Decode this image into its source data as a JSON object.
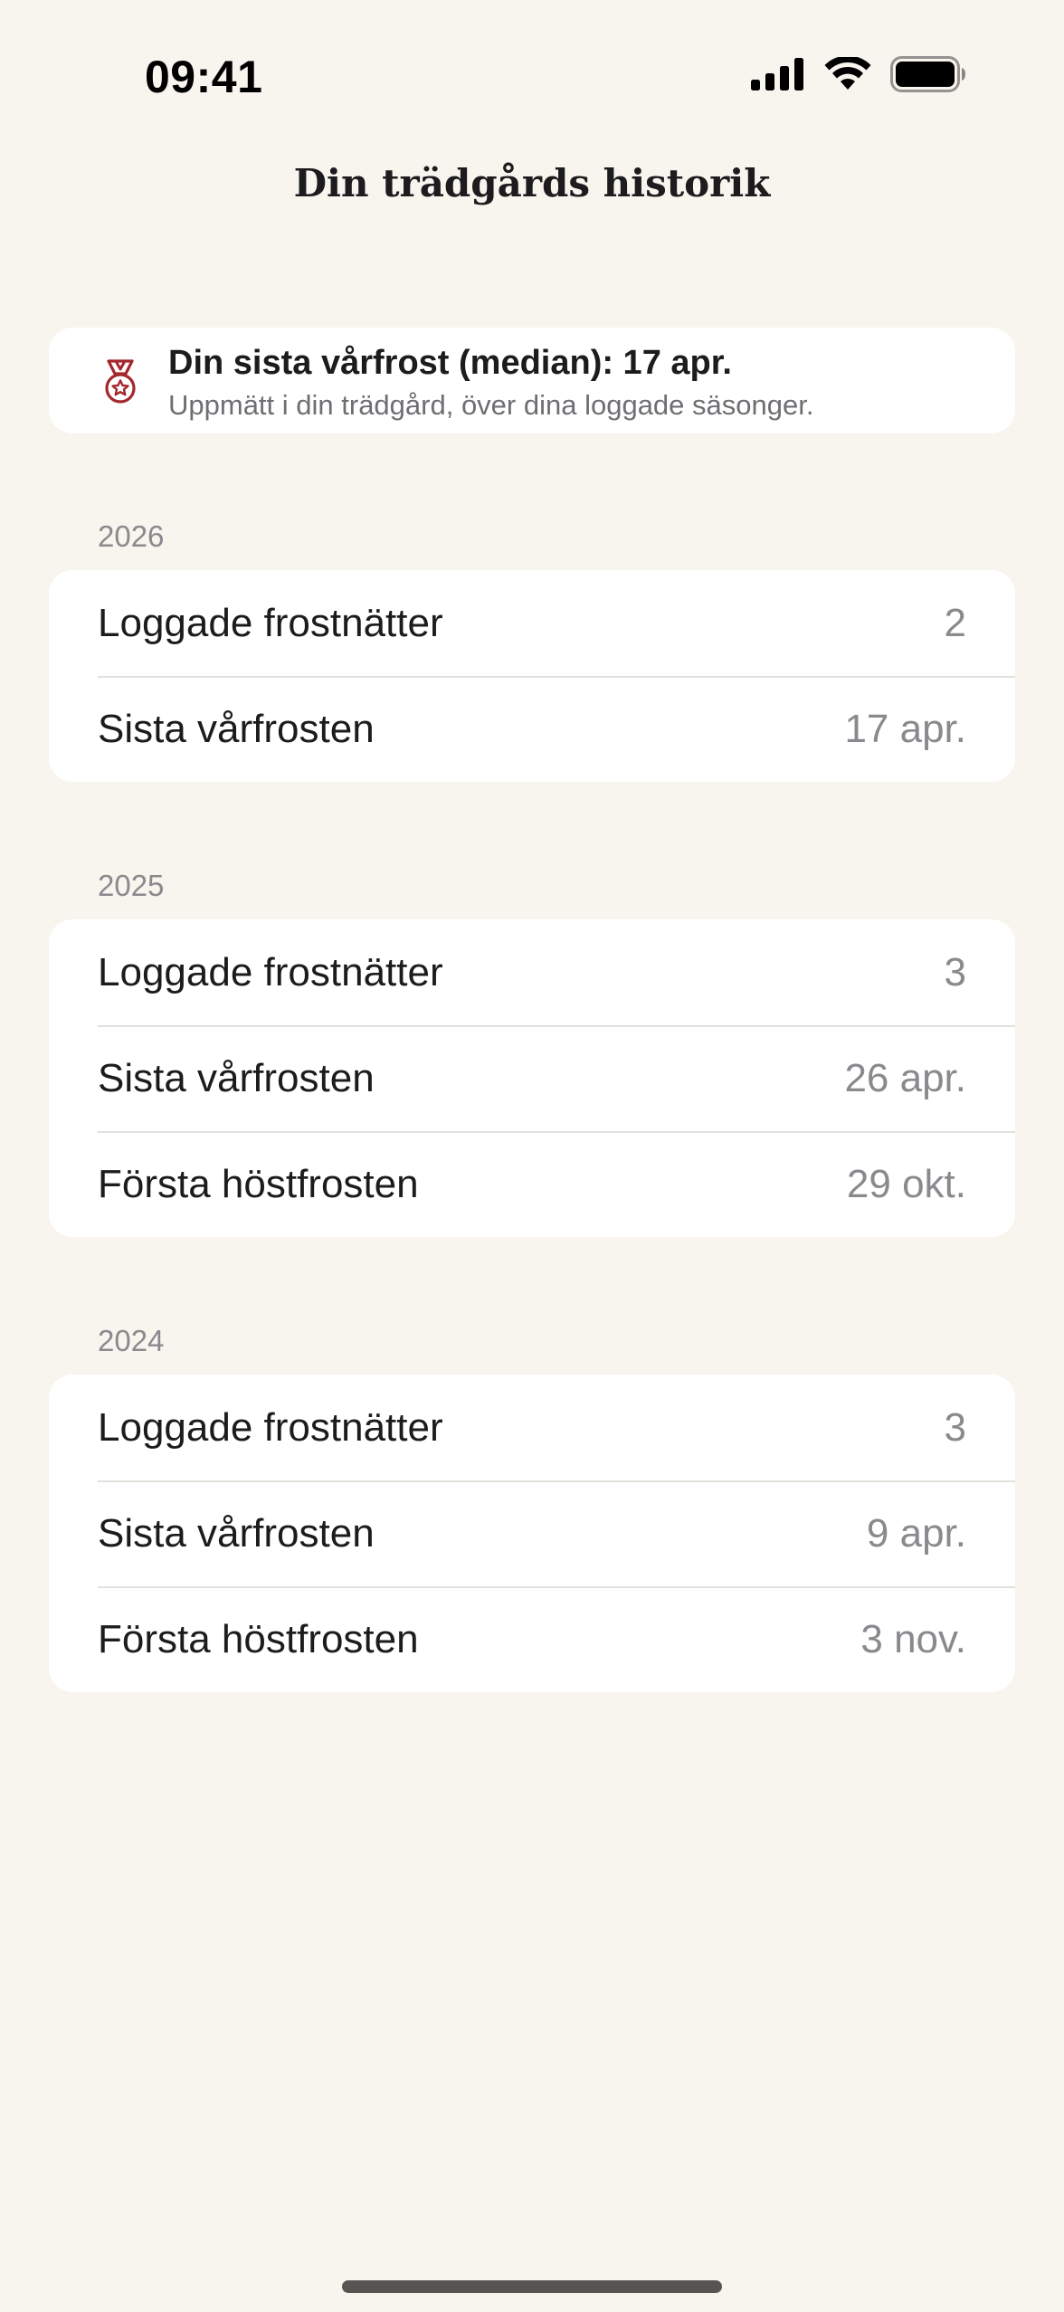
{
  "status_bar": {
    "time": "09:41",
    "signal_icon": "cellular-signal-icon",
    "wifi_icon": "wifi-icon",
    "battery_icon": "battery-icon"
  },
  "nav": {
    "title": "Din trädgårds historik"
  },
  "info": {
    "icon": "medal-icon",
    "icon_color": "#a3282d",
    "title": "Din sista vårfrost (median): 17 apr.",
    "subtitle": "Uppmätt i din trädgård, över dina loggade säsonger."
  },
  "seasons": [
    {
      "year": "2026",
      "rows": [
        {
          "label": "Loggade frostnätter",
          "value": "2"
        },
        {
          "label": "Sista vårfrosten",
          "value": "17 apr."
        }
      ]
    },
    {
      "year": "2025",
      "rows": [
        {
          "label": "Loggade frostnätter",
          "value": "3"
        },
        {
          "label": "Sista vårfrosten",
          "value": "26 apr."
        },
        {
          "label": "Första höstfrosten",
          "value": "29 okt."
        }
      ]
    },
    {
      "year": "2024",
      "rows": [
        {
          "label": "Loggade frostnätter",
          "value": "3"
        },
        {
          "label": "Sista vårfrosten",
          "value": "9 apr."
        },
        {
          "label": "Första höstfrosten",
          "value": "3 nov."
        }
      ]
    }
  ],
  "colors": {
    "background": "#f8f4ee",
    "card": "#ffffff",
    "accent": "#a3282d",
    "secondary_text": "#8a8a8e"
  }
}
